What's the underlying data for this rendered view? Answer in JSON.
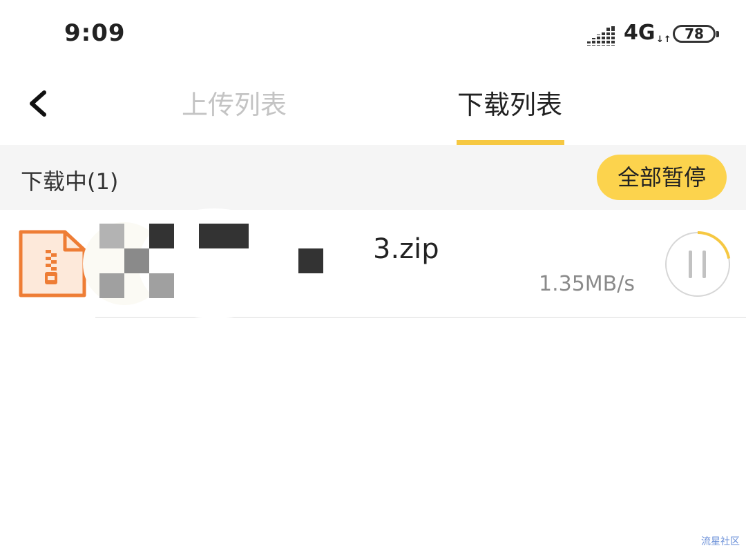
{
  "status_bar": {
    "time": "9:09",
    "network": "4G",
    "network_arrows": "↓↑",
    "battery": "78",
    "icons": [
      "signal-icon",
      "battery-icon"
    ]
  },
  "header": {
    "back_icon": "chevron-left-icon",
    "tabs": [
      {
        "label": "上传列表",
        "active": false
      },
      {
        "label": "下载列表",
        "active": true
      }
    ],
    "accent_color": "#f6c842"
  },
  "section": {
    "title": "下载中(1)",
    "pause_all_label": "全部暂停",
    "button_color": "#fcd34d"
  },
  "downloads": [
    {
      "icon": "zip-file-icon",
      "filename": "3.zip",
      "speed": "1.35MB/s",
      "progress": 0.22,
      "action_icon": "pause-icon"
    }
  ],
  "watermark": "流星社区"
}
